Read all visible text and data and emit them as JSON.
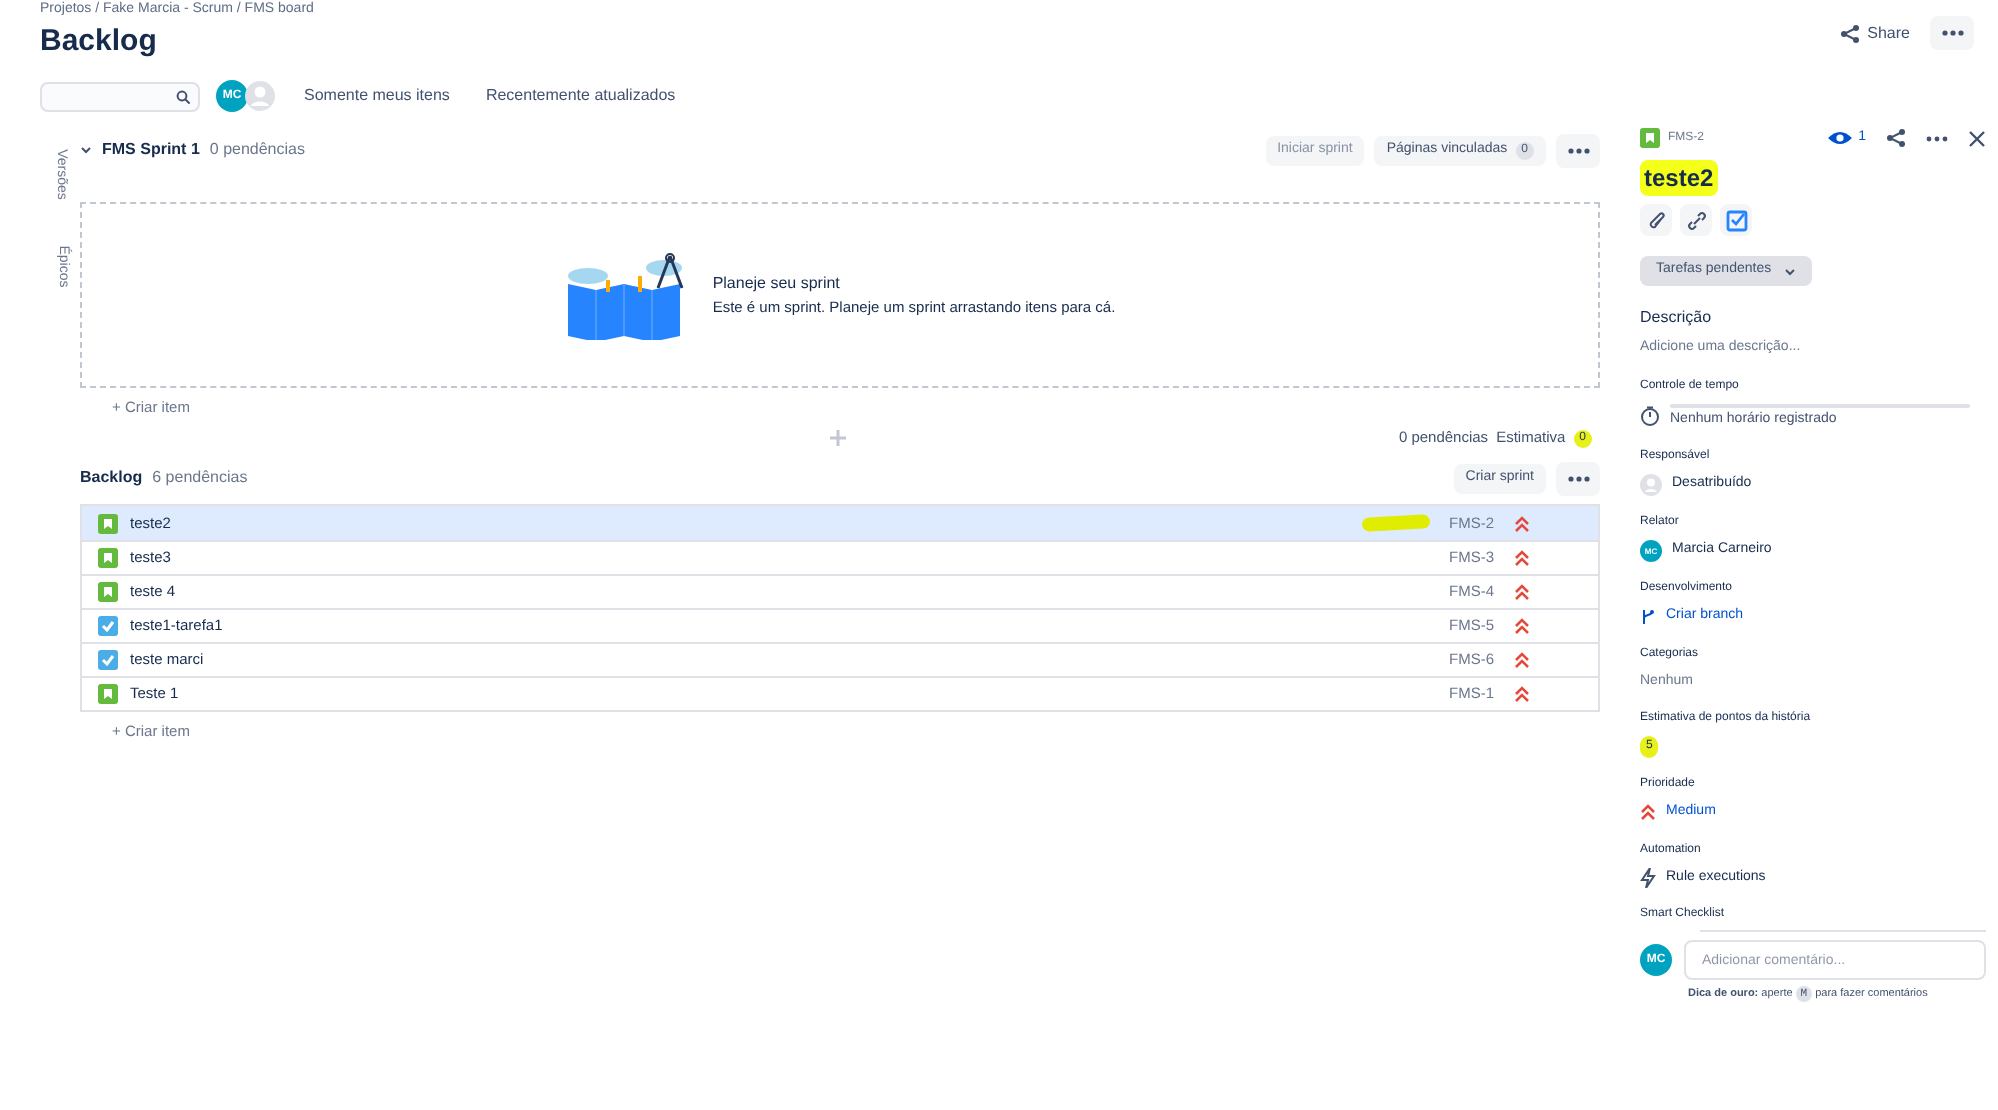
{
  "breadcrumbs": "Projetos / Fake Marcia - Scrum / FMS board",
  "header": {
    "title": "Backlog",
    "share": "Share"
  },
  "filters": {
    "avatar": "MC",
    "items": [
      "Somente meus itens",
      "Recentemente atualizados"
    ]
  },
  "side_tabs": [
    "Versões",
    "Épicos"
  ],
  "sprint": {
    "expanded": true,
    "name": "FMS Sprint 1",
    "count": "0 pendências",
    "start_button": {
      "label": "Iniciar sprint",
      "disabled": true
    },
    "pages_button": {
      "label": "Páginas vinculadas",
      "count": "0"
    },
    "empty": {
      "title": "Planeje seu sprint",
      "text": "Este é um sprint. Planeje um sprint arrastando itens para cá."
    },
    "create": "+ Criar item",
    "footer": {
      "count": "0 pendências",
      "estimate_label": "Estimativa",
      "estimate": "0"
    }
  },
  "backlog": {
    "name": "Backlog",
    "count": "6 pendências",
    "create_sprint": "Criar sprint",
    "create": "+ Criar item",
    "rows": [
      {
        "kind": "story",
        "summary": "teste2",
        "key": "FMS-2",
        "selected": true
      },
      {
        "kind": "story",
        "summary": "teste3",
        "key": "FMS-3",
        "selected": false
      },
      {
        "kind": "story",
        "summary": "teste 4",
        "key": "FMS-4",
        "selected": false
      },
      {
        "kind": "task",
        "summary": "teste1-tarefa1",
        "key": "FMS-5",
        "selected": false
      },
      {
        "kind": "task",
        "summary": "teste marci",
        "key": "FMS-6",
        "selected": false
      },
      {
        "kind": "story",
        "summary": "Teste 1",
        "key": "FMS-1",
        "selected": false
      }
    ]
  },
  "detail": {
    "key": "FMS-2",
    "watchers": "1",
    "title": "teste2",
    "status": "Tarefas pendentes",
    "fields": [
      {
        "kind": "text",
        "label": "Descrição",
        "value": "Adicione uma descrição..."
      },
      {
        "kind": "time",
        "label": "Controle de tempo",
        "value": "Nenhum horário registrado"
      },
      {
        "kind": "unassigned",
        "label": "Responsável",
        "value": "Desatribuído"
      },
      {
        "kind": "user",
        "label": "Relator",
        "avatar": "MC",
        "value": "Marcia Carneiro"
      },
      {
        "kind": "branch",
        "label": "Desenvolvimento",
        "value": "Criar branch"
      },
      {
        "kind": "text",
        "label": "Categorias",
        "value": "Nenhum"
      },
      {
        "kind": "points",
        "label": "Estimativa de pontos da história",
        "value": "5"
      },
      {
        "kind": "priority",
        "label": "Prioridade",
        "value": "Medium"
      },
      {
        "kind": "automation",
        "label": "Automation",
        "value": "Rule executions"
      },
      {
        "kind": "heading",
        "label": "Smart Checklist"
      }
    ],
    "comment": {
      "avatar": "MC",
      "placeholder": "Adicionar comentário...",
      "tip": "**Dica de ouro:** aperte",
      "key": "M",
      "tip_end": "para fazer comentários"
    }
  }
}
